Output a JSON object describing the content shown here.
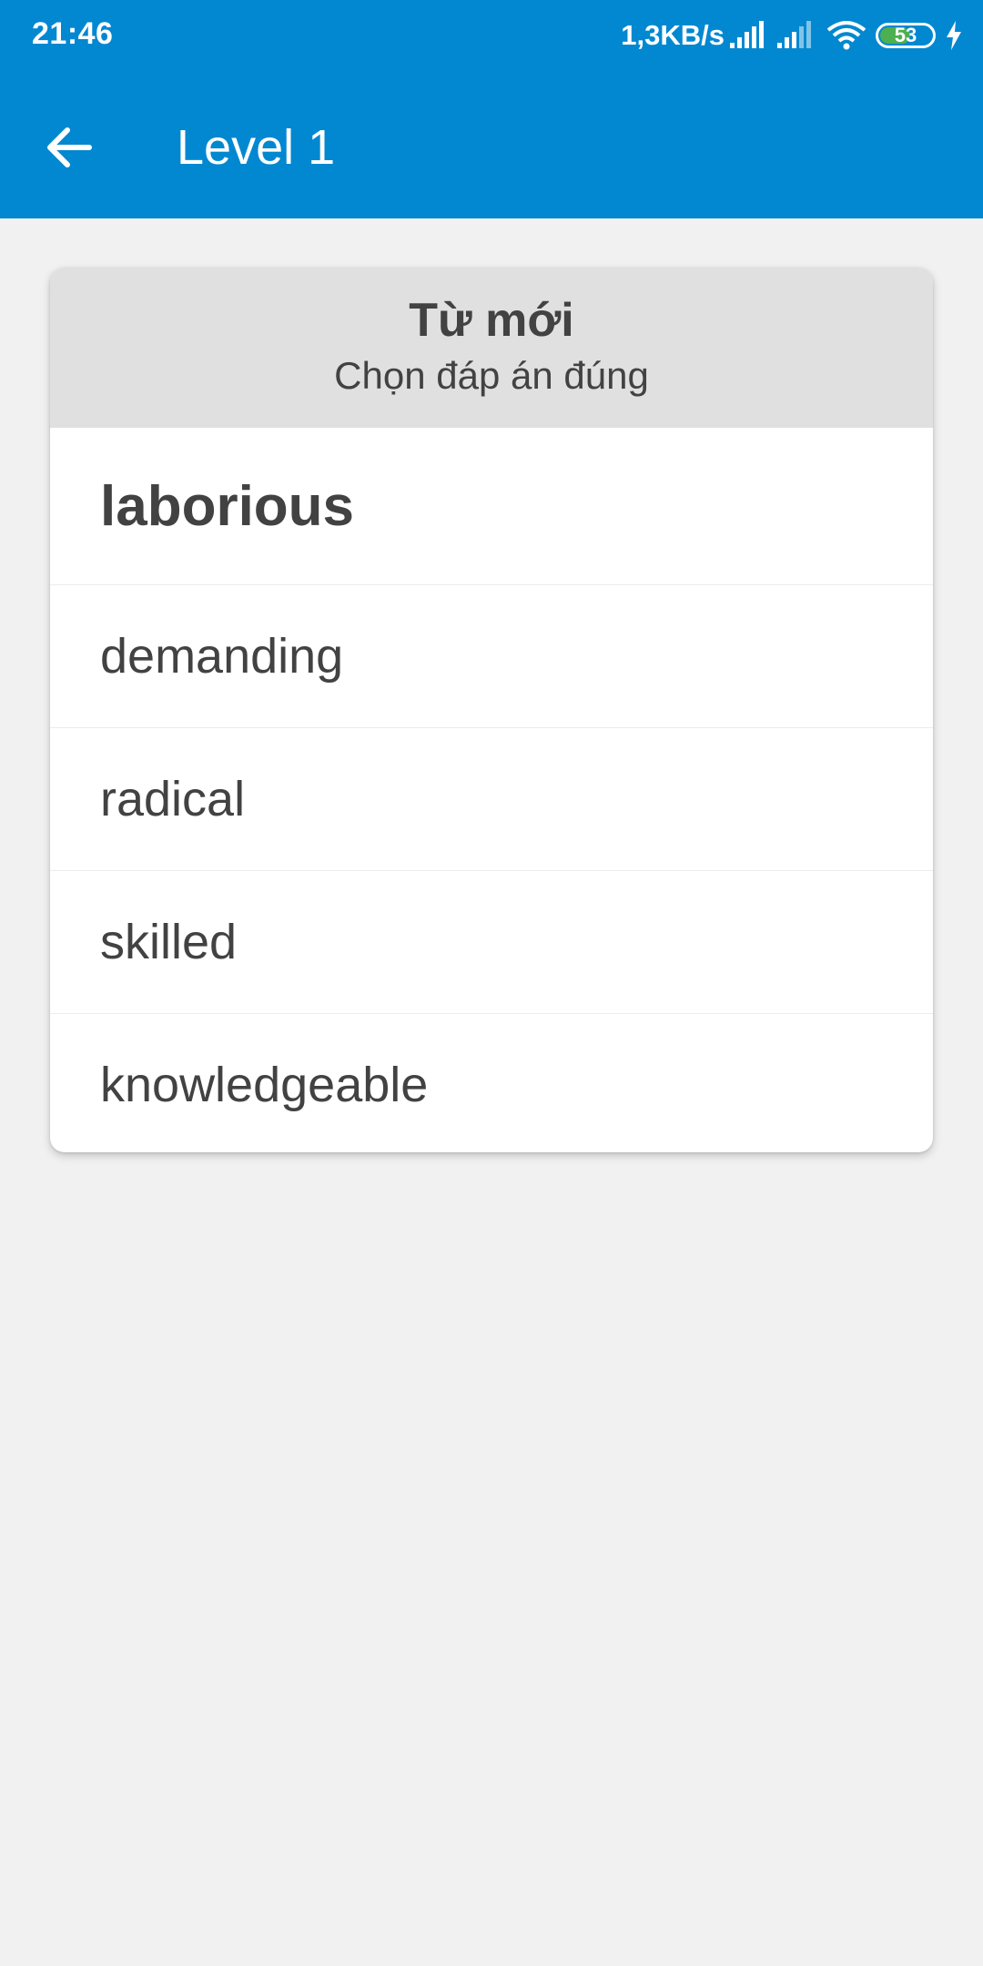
{
  "status_bar": {
    "time": "21:46",
    "net_speed": "1,3KB/s",
    "battery_level": "53",
    "icons": [
      "signal-icon",
      "signal-icon",
      "wifi-icon",
      "battery-icon",
      "charging-icon"
    ]
  },
  "toolbar": {
    "back_icon": "arrow-left-icon",
    "title": "Level 1"
  },
  "card": {
    "title": "Từ mới",
    "subtitle": "Chọn đáp án đúng",
    "word": "laborious",
    "options": [
      {
        "label": "demanding"
      },
      {
        "label": "radical"
      },
      {
        "label": "skilled"
      },
      {
        "label": "knowledgeable"
      }
    ]
  },
  "colors": {
    "appbar": "#0288d1",
    "background": "#f1f1f1",
    "card_header": "#e0e0e0",
    "text": "#424242",
    "battery_fill": "#4caf50"
  }
}
